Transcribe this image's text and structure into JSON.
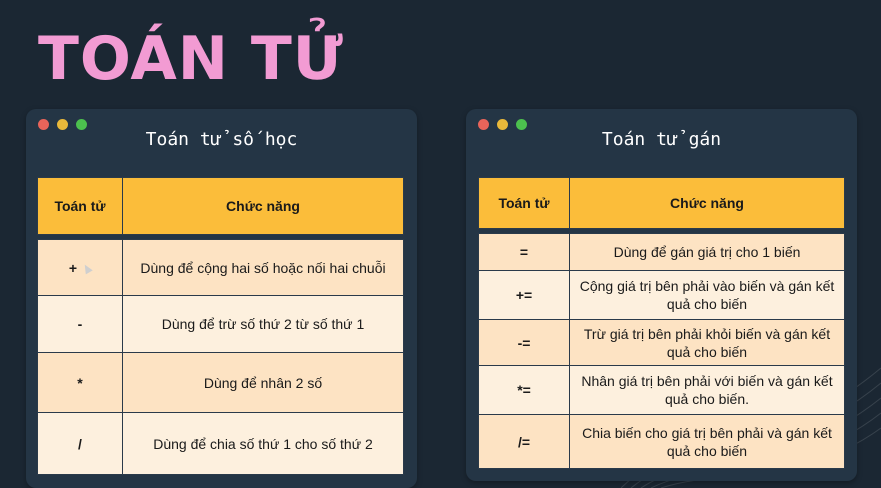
{
  "page": {
    "title": "TOÁN TỬ"
  },
  "colors": {
    "background": "#1b2733",
    "title": "#f29bd3",
    "header": "#fbbd3a",
    "row_odd": "#fde3c3",
    "row_even": "#fdf0de"
  },
  "left_window": {
    "title": "Toán tử số học",
    "headers": [
      "Toán tử",
      "Chức năng"
    ],
    "rows": [
      {
        "op": "+",
        "desc": "Dùng để cộng hai số hoặc nối hai chuỗi"
      },
      {
        "op": "-",
        "desc": "Dùng để trừ số thứ 2 từ số thứ 1"
      },
      {
        "op": "*",
        "desc": "Dùng để nhân 2 số"
      },
      {
        "op": "/",
        "desc": "Dùng để chia số thứ 1 cho số thứ 2"
      }
    ]
  },
  "right_window": {
    "title": "Toán tử gán",
    "headers": [
      "Toán tử",
      "Chức năng"
    ],
    "rows": [
      {
        "op": "=",
        "desc": "Dùng để gán giá trị cho 1 biến"
      },
      {
        "op": "+=",
        "desc": "Cộng giá trị bên phải vào biến và gán kết quả cho biến"
      },
      {
        "op": "-=",
        "desc": "Trừ giá trị bên phải khỏi biến và gán kết quả cho biến"
      },
      {
        "op": "*=",
        "desc": "Nhân giá trị bên phải với biến và gán kết quả cho biến."
      },
      {
        "op": "/=",
        "desc": "Chia biến cho giá trị bên phải và gán kết quả cho biến"
      }
    ]
  }
}
